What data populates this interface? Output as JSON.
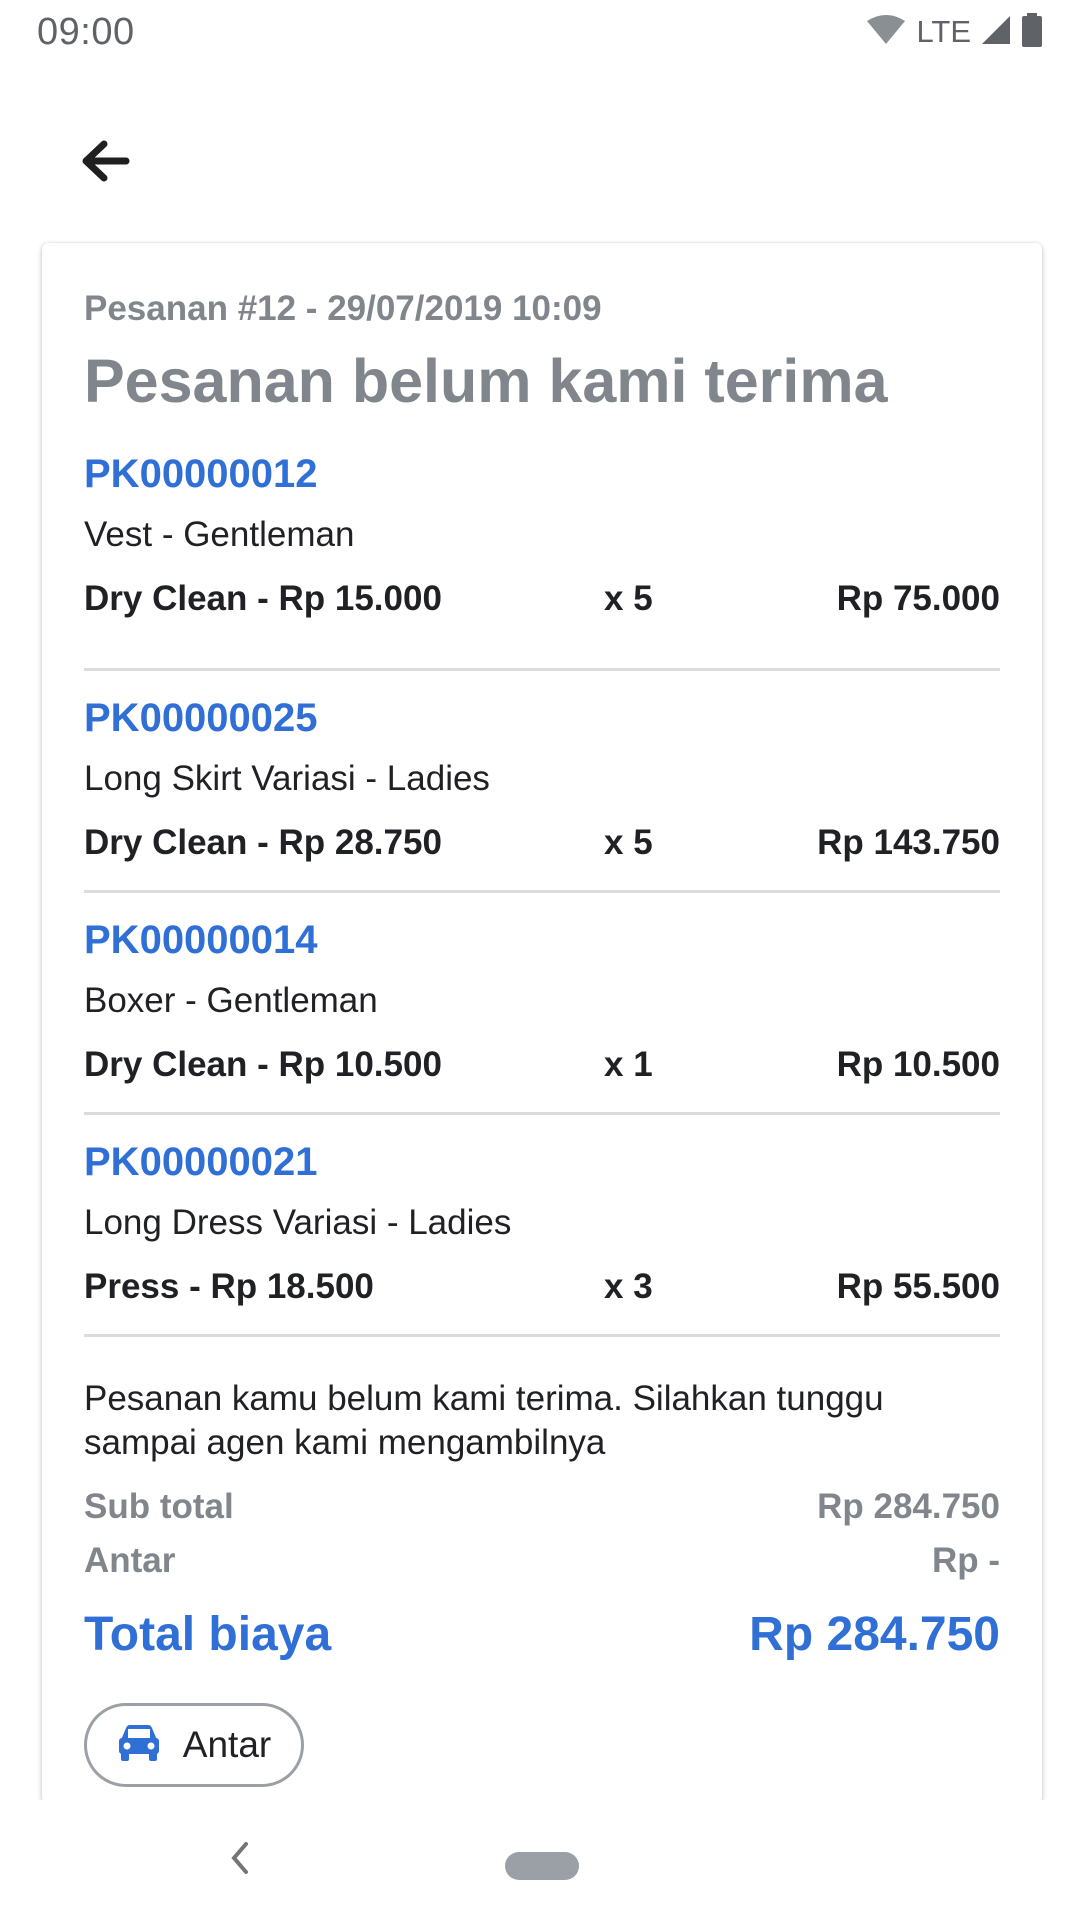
{
  "status_bar": {
    "time": "09:00",
    "network": "LTE",
    "icons": [
      "wifi-icon",
      "signal-icon",
      "battery-icon"
    ]
  },
  "app_bar": {
    "back_icon": "arrow-left-icon"
  },
  "order": {
    "meta": "Pesanan #12 - 29/07/2019 10:09",
    "status_title": "Pesanan belum kami terima",
    "items": [
      {
        "code": "PK00000012",
        "name": "Vest - Gentleman",
        "service": "Dry Clean - Rp 15.000",
        "qty": "x 5",
        "total": "Rp 75.000"
      },
      {
        "code": "PK00000025",
        "name": "Long Skirt Variasi - Ladies",
        "service": "Dry Clean - Rp 28.750",
        "qty": "x 5",
        "total": "Rp 143.750"
      },
      {
        "code": "PK00000014",
        "name": "Boxer - Gentleman",
        "service": "Dry Clean - Rp 10.500",
        "qty": "x 1",
        "total": "Rp 10.500"
      },
      {
        "code": "PK00000021",
        "name": "Long Dress Variasi - Ladies",
        "service": "Press - Rp 18.500",
        "qty": "x 3",
        "total": "Rp 55.500"
      }
    ],
    "note": "Pesanan kamu belum kami terima. Silahkan tunggu sampai agen kami mengambilnya",
    "subtotal_label": "Sub total",
    "subtotal_value": "Rp 284.750",
    "delivery_label": "Antar",
    "delivery_value": "Rp -",
    "total_label": "Total biaya",
    "total_value": "Rp 284.750",
    "action_button": {
      "icon": "car-icon",
      "label": "Antar"
    }
  },
  "colors": {
    "accent": "#2f6fd6",
    "muted_text": "#80868b",
    "primary_text": "#202124",
    "divider": "#dcdcdc"
  },
  "nav_bar": {
    "back_icon": "nav-back-icon",
    "home_icon": "home-pill-icon"
  }
}
